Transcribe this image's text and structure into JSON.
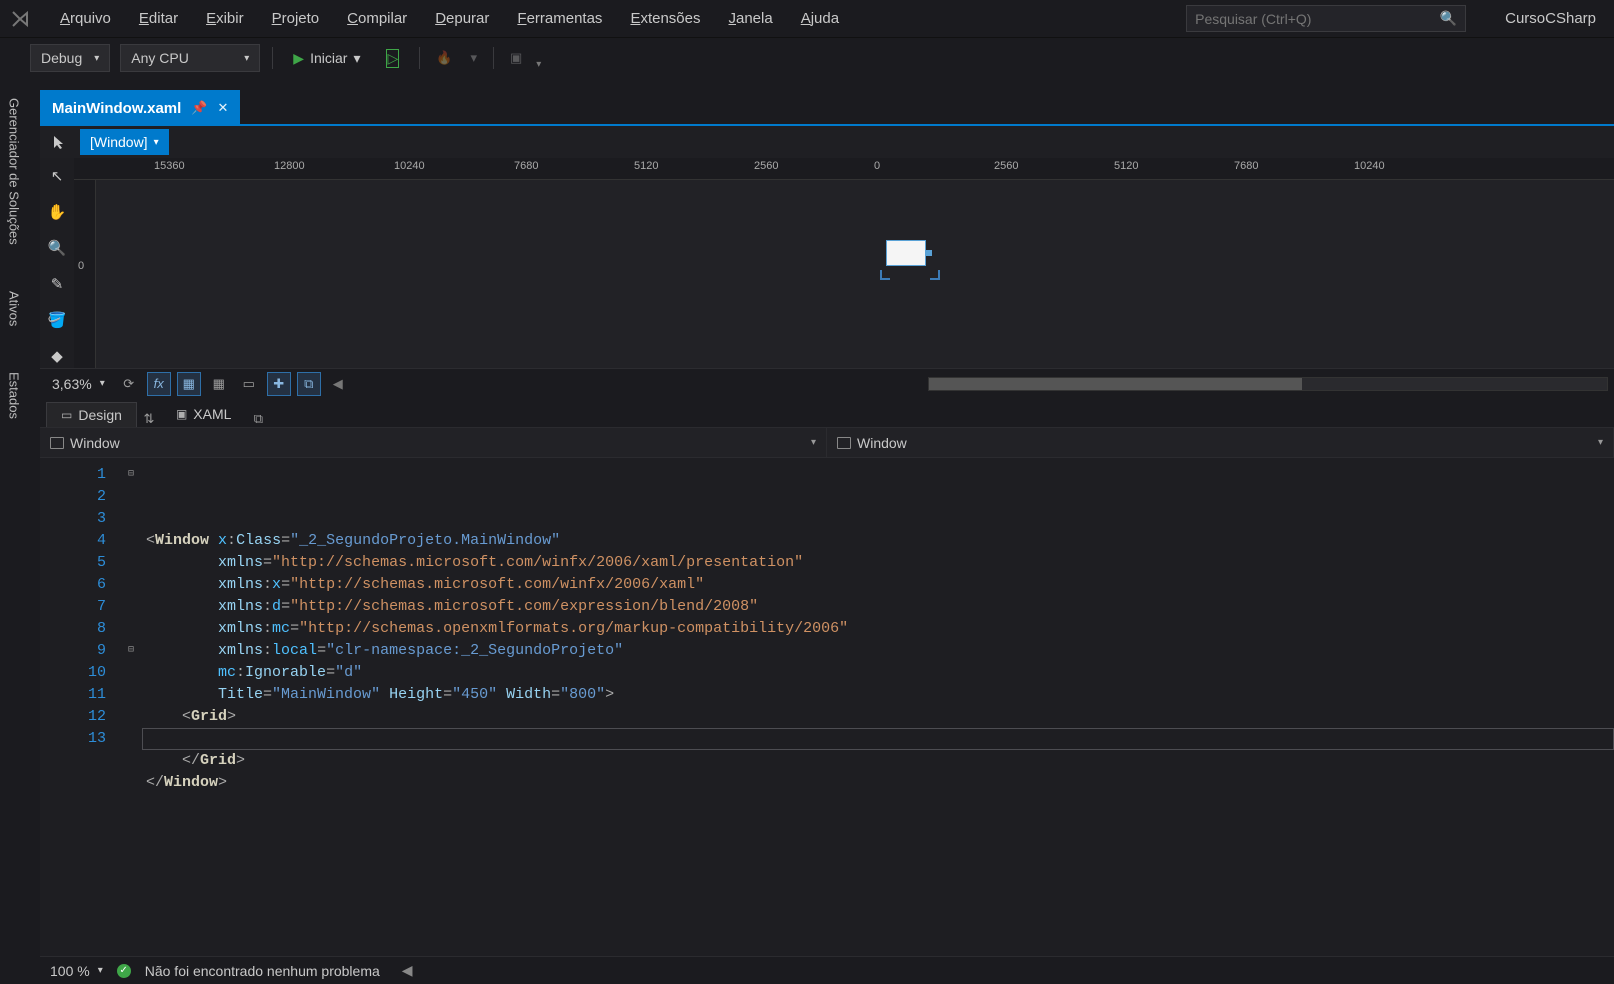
{
  "menu": {
    "items": [
      "Arquivo",
      "Editar",
      "Exibir",
      "Projeto",
      "Compilar",
      "Depurar",
      "Ferramentas",
      "Extensões",
      "Janela",
      "Ajuda"
    ]
  },
  "search": {
    "placeholder": "Pesquisar (Ctrl+Q)"
  },
  "solution_name": "CursoCSharp",
  "toolbar": {
    "config": "Debug",
    "platform": "Any CPU",
    "start": "Iniciar"
  },
  "left_tabs": [
    "Gerenciador de Soluções",
    "Ativos",
    "Estados"
  ],
  "doc_tab": "MainWindow.xaml",
  "designer": {
    "element_dd": "[Window]",
    "ruler_h": [
      "15360",
      "12800",
      "10240",
      "7680",
      "5120",
      "2560",
      "0",
      "2560",
      "5120",
      "7680",
      "10240"
    ],
    "ruler_v_zero": "0",
    "zoom": "3,63%"
  },
  "dx_tabs": {
    "design": "Design",
    "swap": "⇅",
    "xaml": "XAML"
  },
  "crumbs": {
    "left": "Window",
    "right": "Window"
  },
  "code": {
    "tokens": [
      [
        [
          "punc",
          "<"
        ],
        [
          "tag",
          "Window "
        ],
        [
          "ns",
          "x"
        ],
        [
          "punc",
          ":"
        ],
        [
          "attr",
          "Class"
        ],
        [
          "eq",
          "="
        ],
        [
          "strb",
          "\"_2_SegundoProjeto.MainWindow\""
        ]
      ],
      [
        [
          "attr",
          "        xmlns"
        ],
        [
          "eq",
          "="
        ],
        [
          "str",
          "\"http://schemas.microsoft.com/winfx/2006/xaml/presentation\""
        ]
      ],
      [
        [
          "attr",
          "        xmlns"
        ],
        [
          "punc",
          ":"
        ],
        [
          "ns",
          "x"
        ],
        [
          "eq",
          "="
        ],
        [
          "str",
          "\"http://schemas.microsoft.com/winfx/2006/xaml\""
        ]
      ],
      [
        [
          "attr",
          "        xmlns"
        ],
        [
          "punc",
          ":"
        ],
        [
          "ns",
          "d"
        ],
        [
          "eq",
          "="
        ],
        [
          "str",
          "\"http://schemas.microsoft.com/expression/blend/2008\""
        ]
      ],
      [
        [
          "attr",
          "        xmlns"
        ],
        [
          "punc",
          ":"
        ],
        [
          "ns",
          "mc"
        ],
        [
          "eq",
          "="
        ],
        [
          "str",
          "\"http://schemas.openxmlformats.org/markup-compatibility/2006\""
        ]
      ],
      [
        [
          "attr",
          "        xmlns"
        ],
        [
          "punc",
          ":"
        ],
        [
          "ns",
          "local"
        ],
        [
          "eq",
          "="
        ],
        [
          "strb",
          "\"clr-namespace:_2_SegundoProjeto\""
        ]
      ],
      [
        [
          "plain",
          "        "
        ],
        [
          "ns",
          "mc"
        ],
        [
          "punc",
          ":"
        ],
        [
          "attr",
          "Ignorable"
        ],
        [
          "eq",
          "="
        ],
        [
          "strb",
          "\"d\""
        ]
      ],
      [
        [
          "plain",
          "        "
        ],
        [
          "attr",
          "Title"
        ],
        [
          "eq",
          "="
        ],
        [
          "strb",
          "\"MainWindow\" "
        ],
        [
          "attr",
          "Height"
        ],
        [
          "eq",
          "="
        ],
        [
          "strb",
          "\"450\" "
        ],
        [
          "attr",
          "Width"
        ],
        [
          "eq",
          "="
        ],
        [
          "strb",
          "\"800\""
        ],
        [
          "punc",
          ">"
        ]
      ],
      [
        [
          "plain",
          "    "
        ],
        [
          "punc",
          "<"
        ],
        [
          "tag",
          "Grid"
        ],
        [
          "punc",
          ">"
        ]
      ],
      [
        [
          "plain",
          " "
        ]
      ],
      [
        [
          "plain",
          "    "
        ],
        [
          "punc",
          "</"
        ],
        [
          "tag",
          "Grid"
        ],
        [
          "punc",
          ">"
        ]
      ],
      [
        [
          "punc",
          "</"
        ],
        [
          "tag",
          "Window"
        ],
        [
          "punc",
          ">"
        ]
      ],
      [
        [
          "plain",
          " "
        ]
      ]
    ],
    "line_count": 13
  },
  "editor_status": {
    "zoom": "100 %",
    "ok_msg": "Não foi encontrado nenhum problema"
  }
}
